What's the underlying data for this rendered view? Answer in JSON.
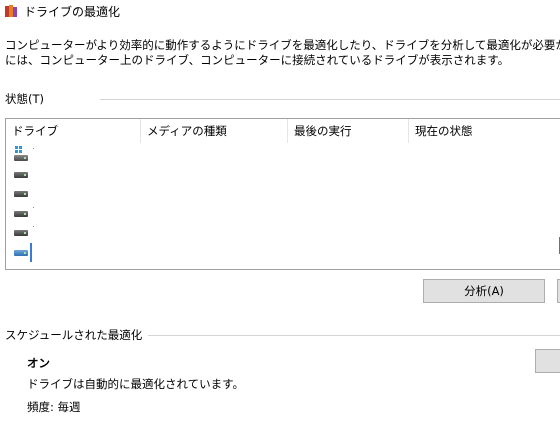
{
  "window": {
    "title": "ドライブの最適化"
  },
  "description": {
    "line1": "コンピューターがより効率的に動作するようにドライブを最適化したり、ドライブを分析して最適化が必要かどうかを確認したりできます。",
    "line2": "には、コンピューター上のドライブ、コンピューターに接続されているドライブが表示されます。"
  },
  "status_section": {
    "label": "状態(T)"
  },
  "drive_list": {
    "columns": [
      "ドライブ",
      "メディアの種類",
      "最後の実行",
      "現在の状態"
    ],
    "rows": [
      {
        "icon": "system-drive-icon"
      },
      {
        "icon": "hard-drive-icon"
      },
      {
        "icon": "hard-drive-icon"
      },
      {
        "icon": "hard-drive-icon"
      },
      {
        "icon": "hard-drive-icon"
      },
      {
        "icon": "network-drive-icon",
        "selected": true
      }
    ]
  },
  "buttons": {
    "analyze": "分析(A)"
  },
  "schedule_section": {
    "label": "スケジュールされた最適化",
    "status": "オン",
    "description": "ドライブは自動的に最適化されています。",
    "frequency": "頻度: 毎週"
  },
  "colors": {
    "accent": "#3a7bd5",
    "button_bg": "#e1e1e1",
    "border": "#a0a0a0"
  }
}
